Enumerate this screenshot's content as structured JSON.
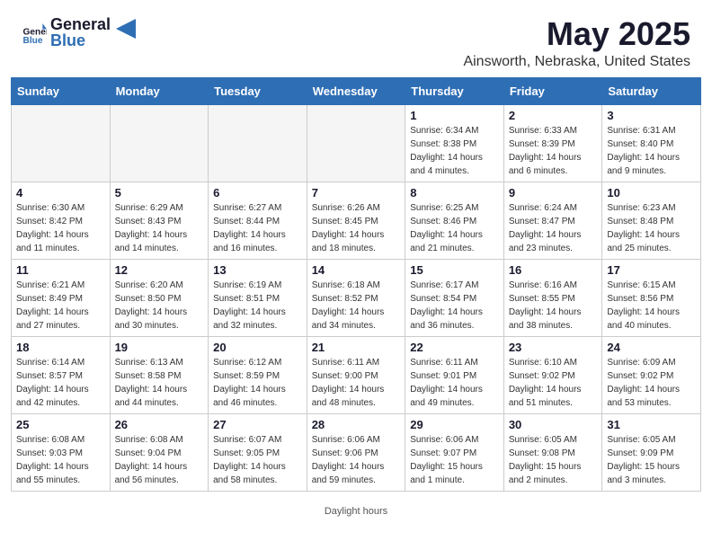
{
  "header": {
    "logo_general": "General",
    "logo_blue": "Blue",
    "month": "May 2025",
    "location": "Ainsworth, Nebraska, United States"
  },
  "weekdays": [
    "Sunday",
    "Monday",
    "Tuesday",
    "Wednesday",
    "Thursday",
    "Friday",
    "Saturday"
  ],
  "footer": "Daylight hours",
  "weeks": [
    [
      {
        "day": "",
        "info": ""
      },
      {
        "day": "",
        "info": ""
      },
      {
        "day": "",
        "info": ""
      },
      {
        "day": "",
        "info": ""
      },
      {
        "day": "1",
        "info": "Sunrise: 6:34 AM\nSunset: 8:38 PM\nDaylight: 14 hours\nand 4 minutes."
      },
      {
        "day": "2",
        "info": "Sunrise: 6:33 AM\nSunset: 8:39 PM\nDaylight: 14 hours\nand 6 minutes."
      },
      {
        "day": "3",
        "info": "Sunrise: 6:31 AM\nSunset: 8:40 PM\nDaylight: 14 hours\nand 9 minutes."
      }
    ],
    [
      {
        "day": "4",
        "info": "Sunrise: 6:30 AM\nSunset: 8:42 PM\nDaylight: 14 hours\nand 11 minutes."
      },
      {
        "day": "5",
        "info": "Sunrise: 6:29 AM\nSunset: 8:43 PM\nDaylight: 14 hours\nand 14 minutes."
      },
      {
        "day": "6",
        "info": "Sunrise: 6:27 AM\nSunset: 8:44 PM\nDaylight: 14 hours\nand 16 minutes."
      },
      {
        "day": "7",
        "info": "Sunrise: 6:26 AM\nSunset: 8:45 PM\nDaylight: 14 hours\nand 18 minutes."
      },
      {
        "day": "8",
        "info": "Sunrise: 6:25 AM\nSunset: 8:46 PM\nDaylight: 14 hours\nand 21 minutes."
      },
      {
        "day": "9",
        "info": "Sunrise: 6:24 AM\nSunset: 8:47 PM\nDaylight: 14 hours\nand 23 minutes."
      },
      {
        "day": "10",
        "info": "Sunrise: 6:23 AM\nSunset: 8:48 PM\nDaylight: 14 hours\nand 25 minutes."
      }
    ],
    [
      {
        "day": "11",
        "info": "Sunrise: 6:21 AM\nSunset: 8:49 PM\nDaylight: 14 hours\nand 27 minutes."
      },
      {
        "day": "12",
        "info": "Sunrise: 6:20 AM\nSunset: 8:50 PM\nDaylight: 14 hours\nand 30 minutes."
      },
      {
        "day": "13",
        "info": "Sunrise: 6:19 AM\nSunset: 8:51 PM\nDaylight: 14 hours\nand 32 minutes."
      },
      {
        "day": "14",
        "info": "Sunrise: 6:18 AM\nSunset: 8:52 PM\nDaylight: 14 hours\nand 34 minutes."
      },
      {
        "day": "15",
        "info": "Sunrise: 6:17 AM\nSunset: 8:54 PM\nDaylight: 14 hours\nand 36 minutes."
      },
      {
        "day": "16",
        "info": "Sunrise: 6:16 AM\nSunset: 8:55 PM\nDaylight: 14 hours\nand 38 minutes."
      },
      {
        "day": "17",
        "info": "Sunrise: 6:15 AM\nSunset: 8:56 PM\nDaylight: 14 hours\nand 40 minutes."
      }
    ],
    [
      {
        "day": "18",
        "info": "Sunrise: 6:14 AM\nSunset: 8:57 PM\nDaylight: 14 hours\nand 42 minutes."
      },
      {
        "day": "19",
        "info": "Sunrise: 6:13 AM\nSunset: 8:58 PM\nDaylight: 14 hours\nand 44 minutes."
      },
      {
        "day": "20",
        "info": "Sunrise: 6:12 AM\nSunset: 8:59 PM\nDaylight: 14 hours\nand 46 minutes."
      },
      {
        "day": "21",
        "info": "Sunrise: 6:11 AM\nSunset: 9:00 PM\nDaylight: 14 hours\nand 48 minutes."
      },
      {
        "day": "22",
        "info": "Sunrise: 6:11 AM\nSunset: 9:01 PM\nDaylight: 14 hours\nand 49 minutes."
      },
      {
        "day": "23",
        "info": "Sunrise: 6:10 AM\nSunset: 9:02 PM\nDaylight: 14 hours\nand 51 minutes."
      },
      {
        "day": "24",
        "info": "Sunrise: 6:09 AM\nSunset: 9:02 PM\nDaylight: 14 hours\nand 53 minutes."
      }
    ],
    [
      {
        "day": "25",
        "info": "Sunrise: 6:08 AM\nSunset: 9:03 PM\nDaylight: 14 hours\nand 55 minutes."
      },
      {
        "day": "26",
        "info": "Sunrise: 6:08 AM\nSunset: 9:04 PM\nDaylight: 14 hours\nand 56 minutes."
      },
      {
        "day": "27",
        "info": "Sunrise: 6:07 AM\nSunset: 9:05 PM\nDaylight: 14 hours\nand 58 minutes."
      },
      {
        "day": "28",
        "info": "Sunrise: 6:06 AM\nSunset: 9:06 PM\nDaylight: 14 hours\nand 59 minutes."
      },
      {
        "day": "29",
        "info": "Sunrise: 6:06 AM\nSunset: 9:07 PM\nDaylight: 15 hours\nand 1 minute."
      },
      {
        "day": "30",
        "info": "Sunrise: 6:05 AM\nSunset: 9:08 PM\nDaylight: 15 hours\nand 2 minutes."
      },
      {
        "day": "31",
        "info": "Sunrise: 6:05 AM\nSunset: 9:09 PM\nDaylight: 15 hours\nand 3 minutes."
      }
    ]
  ]
}
